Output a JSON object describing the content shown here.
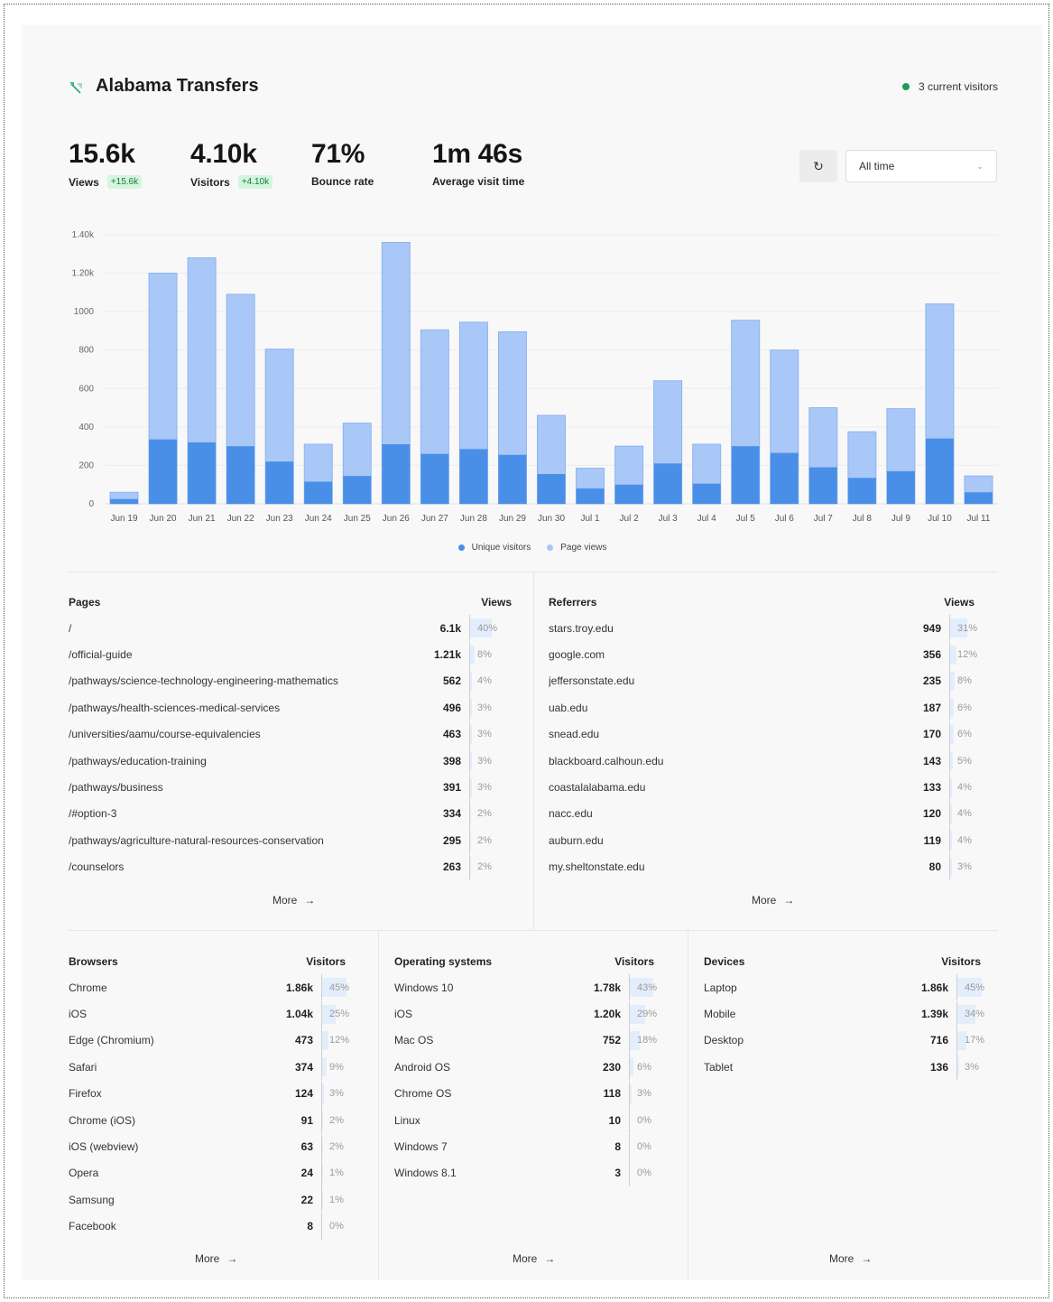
{
  "site": {
    "name": "Alabama Transfers",
    "logo_icon": "website-favicon-icon"
  },
  "live": {
    "text": "3 current visitors",
    "color": "#1f9d55"
  },
  "metrics": [
    {
      "value": "15.6k",
      "label": "Views",
      "delta": "+15.6k"
    },
    {
      "value": "4.10k",
      "label": "Visitors",
      "delta": "+4.10k"
    },
    {
      "value": "71%",
      "label": "Bounce rate"
    },
    {
      "value": "1m 46s",
      "label": "Average visit time"
    }
  ],
  "controls": {
    "refresh_icon": "refresh-icon",
    "range_value": "All time",
    "range_icon": "chevron-down-icon"
  },
  "colors": {
    "unique": "#4a8fe7",
    "views": "#a9c8f8",
    "accent_green": "#1f9d55"
  },
  "chart_data": {
    "type": "bar",
    "stacked": true,
    "categories": [
      "Jun 19",
      "Jun 20",
      "Jun 21",
      "Jun 22",
      "Jun 23",
      "Jun 24",
      "Jun 25",
      "Jun 26",
      "Jun 27",
      "Jun 28",
      "Jun 29",
      "Jun 30",
      "Jul 1",
      "Jul 2",
      "Jul 3",
      "Jul 4",
      "Jul 5",
      "Jul 6",
      "Jul 7",
      "Jul 8",
      "Jul 9",
      "Jul 10",
      "Jul 11"
    ],
    "series": [
      {
        "name": "Unique visitors",
        "color": "#4a8fe7",
        "values": [
          25,
          335,
          320,
          300,
          220,
          115,
          145,
          310,
          260,
          285,
          255,
          155,
          80,
          100,
          210,
          105,
          300,
          265,
          190,
          135,
          170,
          340,
          60
        ]
      },
      {
        "name": "Page views",
        "color": "#a9c8f8",
        "values": [
          60,
          1200,
          1280,
          1090,
          805,
          310,
          420,
          1360,
          905,
          945,
          895,
          460,
          185,
          300,
          640,
          310,
          955,
          800,
          500,
          375,
          495,
          1040,
          145
        ]
      }
    ],
    "yticks": [
      "0",
      "200",
      "400",
      "600",
      "800",
      "1000",
      "1.20k",
      "1.40k"
    ],
    "ylim": [
      0,
      1400
    ],
    "grid": true,
    "legend": "bottom-center"
  },
  "pages": {
    "header": "Pages",
    "value_header": "Views",
    "more": "More",
    "rows": [
      {
        "label": "/",
        "value": "6.1k",
        "pct": "40%",
        "share": 0.4
      },
      {
        "label": "/official-guide",
        "value": "1.21k",
        "pct": "8%",
        "share": 0.08
      },
      {
        "label": "/pathways/science-technology-engineering-mathematics",
        "value": "562",
        "pct": "4%",
        "share": 0.04
      },
      {
        "label": "/pathways/health-sciences-medical-services",
        "value": "496",
        "pct": "3%",
        "share": 0.03
      },
      {
        "label": "/universities/aamu/course-equivalencies",
        "value": "463",
        "pct": "3%",
        "share": 0.03
      },
      {
        "label": "/pathways/education-training",
        "value": "398",
        "pct": "3%",
        "share": 0.03
      },
      {
        "label": "/pathways/business",
        "value": "391",
        "pct": "3%",
        "share": 0.03
      },
      {
        "label": "/#option-3",
        "value": "334",
        "pct": "2%",
        "share": 0.02
      },
      {
        "label": "/pathways/agriculture-natural-resources-conservation",
        "value": "295",
        "pct": "2%",
        "share": 0.02
      },
      {
        "label": "/counselors",
        "value": "263",
        "pct": "2%",
        "share": 0.02
      }
    ]
  },
  "referrers": {
    "header": "Referrers",
    "value_header": "Views",
    "more": "More",
    "rows": [
      {
        "label": "stars.troy.edu",
        "value": "949",
        "pct": "31%",
        "share": 0.31
      },
      {
        "label": "google.com",
        "value": "356",
        "pct": "12%",
        "share": 0.12
      },
      {
        "label": "jeffersonstate.edu",
        "value": "235",
        "pct": "8%",
        "share": 0.08
      },
      {
        "label": "uab.edu",
        "value": "187",
        "pct": "6%",
        "share": 0.06
      },
      {
        "label": "snead.edu",
        "value": "170",
        "pct": "6%",
        "share": 0.06
      },
      {
        "label": "blackboard.calhoun.edu",
        "value": "143",
        "pct": "5%",
        "share": 0.05
      },
      {
        "label": "coastalalabama.edu",
        "value": "133",
        "pct": "4%",
        "share": 0.04
      },
      {
        "label": "nacc.edu",
        "value": "120",
        "pct": "4%",
        "share": 0.04
      },
      {
        "label": "auburn.edu",
        "value": "119",
        "pct": "4%",
        "share": 0.04
      },
      {
        "label": "my.sheltonstate.edu",
        "value": "80",
        "pct": "3%",
        "share": 0.03
      }
    ]
  },
  "browsers": {
    "header": "Browsers",
    "value_header": "Visitors",
    "more": "More",
    "rows": [
      {
        "label": "Chrome",
        "value": "1.86k",
        "pct": "45%",
        "share": 0.45
      },
      {
        "label": "iOS",
        "value": "1.04k",
        "pct": "25%",
        "share": 0.25
      },
      {
        "label": "Edge (Chromium)",
        "value": "473",
        "pct": "12%",
        "share": 0.12
      },
      {
        "label": "Safari",
        "value": "374",
        "pct": "9%",
        "share": 0.09
      },
      {
        "label": "Firefox",
        "value": "124",
        "pct": "3%",
        "share": 0.03
      },
      {
        "label": "Chrome (iOS)",
        "value": "91",
        "pct": "2%",
        "share": 0.02
      },
      {
        "label": "iOS (webview)",
        "value": "63",
        "pct": "2%",
        "share": 0.02
      },
      {
        "label": "Opera",
        "value": "24",
        "pct": "1%",
        "share": 0.01
      },
      {
        "label": "Samsung",
        "value": "22",
        "pct": "1%",
        "share": 0.01
      },
      {
        "label": "Facebook",
        "value": "8",
        "pct": "0%",
        "share": 0.0
      }
    ]
  },
  "os": {
    "header": "Operating systems",
    "value_header": "Visitors",
    "more": "More",
    "rows": [
      {
        "label": "Windows 10",
        "value": "1.78k",
        "pct": "43%",
        "share": 0.43
      },
      {
        "label": "iOS",
        "value": "1.20k",
        "pct": "29%",
        "share": 0.29
      },
      {
        "label": "Mac OS",
        "value": "752",
        "pct": "18%",
        "share": 0.18
      },
      {
        "label": "Android OS",
        "value": "230",
        "pct": "6%",
        "share": 0.06
      },
      {
        "label": "Chrome OS",
        "value": "118",
        "pct": "3%",
        "share": 0.03
      },
      {
        "label": "Linux",
        "value": "10",
        "pct": "0%",
        "share": 0.0
      },
      {
        "label": "Windows 7",
        "value": "8",
        "pct": "0%",
        "share": 0.0
      },
      {
        "label": "Windows 8.1",
        "value": "3",
        "pct": "0%",
        "share": 0.0
      }
    ]
  },
  "devices": {
    "header": "Devices",
    "value_header": "Visitors",
    "more": "More",
    "rows": [
      {
        "label": "Laptop",
        "value": "1.86k",
        "pct": "45%",
        "share": 0.45
      },
      {
        "label": "Mobile",
        "value": "1.39k",
        "pct": "34%",
        "share": 0.34
      },
      {
        "label": "Desktop",
        "value": "716",
        "pct": "17%",
        "share": 0.17
      },
      {
        "label": "Tablet",
        "value": "136",
        "pct": "3%",
        "share": 0.03
      }
    ]
  }
}
